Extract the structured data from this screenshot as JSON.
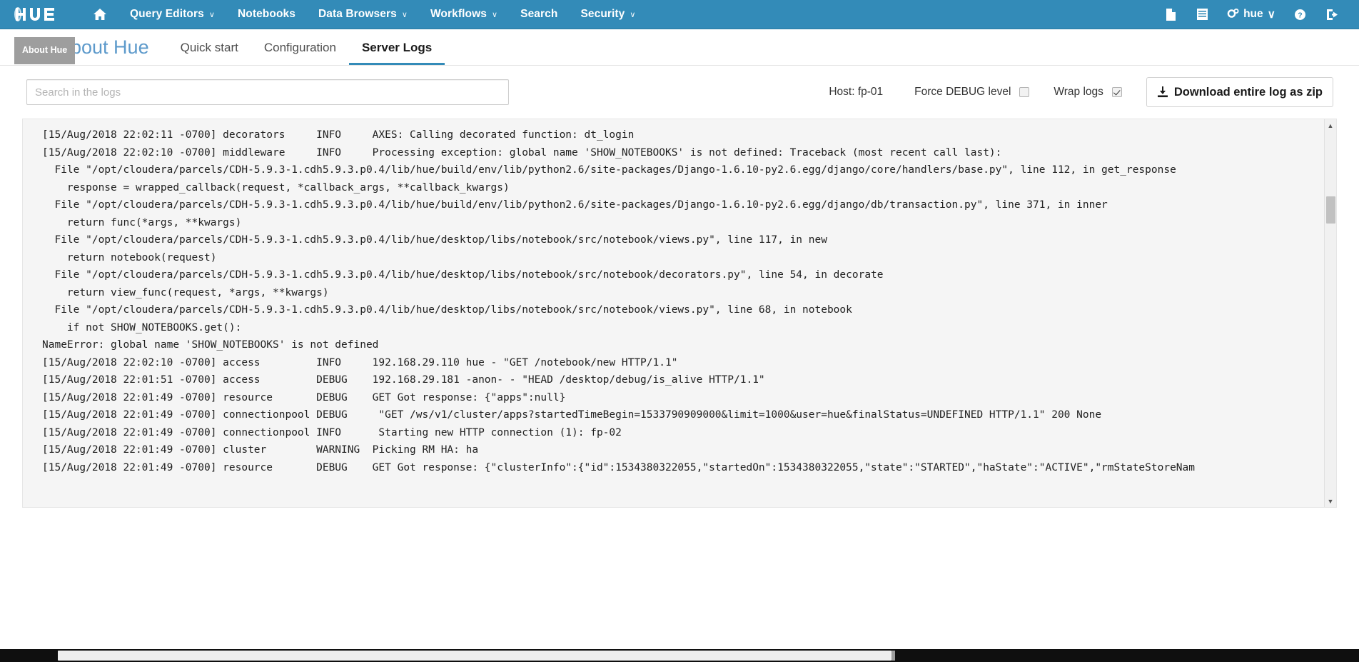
{
  "navbar": {
    "logo_text": "hue",
    "home_icon": "home-icon",
    "items": [
      {
        "label": "Query Editors",
        "caret": "∨",
        "has_caret": true
      },
      {
        "label": "Notebooks",
        "caret": "",
        "has_caret": false
      },
      {
        "label": "Data Browsers",
        "caret": "∨",
        "has_caret": true
      },
      {
        "label": "Workflows",
        "caret": "∨",
        "has_caret": true
      },
      {
        "label": "Search",
        "caret": "",
        "has_caret": false
      },
      {
        "label": "Security",
        "caret": "∨",
        "has_caret": true
      }
    ],
    "right": {
      "documents_icon": "document-icon",
      "jobs_icon": "list-icon",
      "user_label": "hue",
      "user_caret": "∨",
      "help_icon": "help-circle-icon",
      "logout_icon": "logout-icon"
    },
    "brand_color": "#338bb8"
  },
  "subheader": {
    "page_title": "About Hue",
    "tooltip": "About Hue",
    "tabs": [
      {
        "label": "Quick start",
        "active": false
      },
      {
        "label": "Configuration",
        "active": false
      },
      {
        "label": "Server Logs",
        "active": true
      }
    ],
    "active_tab_color": "#338bb8",
    "title_color": "#5d9acb"
  },
  "controls": {
    "search_placeholder": "Search in the logs",
    "search_value": "",
    "host_label": "Host: fp-01",
    "force_debug_label": "Force DEBUG level",
    "force_debug_checked": false,
    "wrap_logs_label": "Wrap logs",
    "wrap_logs_checked": true,
    "download_label": "Download entire log as zip",
    "download_icon": "download-icon"
  },
  "log": {
    "lines": [
      "[15/Aug/2018 22:02:11 -0700] decorators     INFO     AXES: Calling decorated function: dt_login",
      "[15/Aug/2018 22:02:10 -0700] middleware     INFO     Processing exception: global name 'SHOW_NOTEBOOKS' is not defined: Traceback (most recent call last):",
      "  File \"/opt/cloudera/parcels/CDH-5.9.3-1.cdh5.9.3.p0.4/lib/hue/build/env/lib/python2.6/site-packages/Django-1.6.10-py2.6.egg/django/core/handlers/base.py\", line 112, in get_response",
      "    response = wrapped_callback(request, *callback_args, **callback_kwargs)",
      "  File \"/opt/cloudera/parcels/CDH-5.9.3-1.cdh5.9.3.p0.4/lib/hue/build/env/lib/python2.6/site-packages/Django-1.6.10-py2.6.egg/django/db/transaction.py\", line 371, in inner",
      "    return func(*args, **kwargs)",
      "  File \"/opt/cloudera/parcels/CDH-5.9.3-1.cdh5.9.3.p0.4/lib/hue/desktop/libs/notebook/src/notebook/views.py\", line 117, in new",
      "    return notebook(request)",
      "  File \"/opt/cloudera/parcels/CDH-5.9.3-1.cdh5.9.3.p0.4/lib/hue/desktop/libs/notebook/src/notebook/decorators.py\", line 54, in decorate",
      "    return view_func(request, *args, **kwargs)",
      "  File \"/opt/cloudera/parcels/CDH-5.9.3-1.cdh5.9.3.p0.4/lib/hue/desktop/libs/notebook/src/notebook/views.py\", line 68, in notebook",
      "    if not SHOW_NOTEBOOKS.get():",
      "NameError: global name 'SHOW_NOTEBOOKS' is not defined",
      "[15/Aug/2018 22:02:10 -0700] access         INFO     192.168.29.110 hue - \"GET /notebook/new HTTP/1.1\"",
      "[15/Aug/2018 22:01:51 -0700] access         DEBUG    192.168.29.181 -anon- - \"HEAD /desktop/debug/is_alive HTTP/1.1\"",
      "[15/Aug/2018 22:01:49 -0700] resource       DEBUG    GET Got response: {\"apps\":null}",
      "[15/Aug/2018 22:01:49 -0700] connectionpool DEBUG     \"GET /ws/v1/cluster/apps?startedTimeBegin=1533790909000&limit=1000&user=hue&finalStatus=UNDEFINED HTTP/1.1\" 200 None",
      "[15/Aug/2018 22:01:49 -0700] connectionpool INFO      Starting new HTTP connection (1): fp-02",
      "[15/Aug/2018 22:01:49 -0700] cluster        WARNING  Picking RM HA: ha",
      "[15/Aug/2018 22:01:49 -0700] resource       DEBUG    GET Got response: {\"clusterInfo\":{\"id\":1534380322055,\"startedOn\":1534380322055,\"state\":\"STARTED\",\"haState\":\"ACTIVE\",\"rmStateStoreNam"
    ]
  },
  "scrollbars": {
    "vertical_up_arrow": "▲",
    "vertical_down_arrow": "▼"
  }
}
